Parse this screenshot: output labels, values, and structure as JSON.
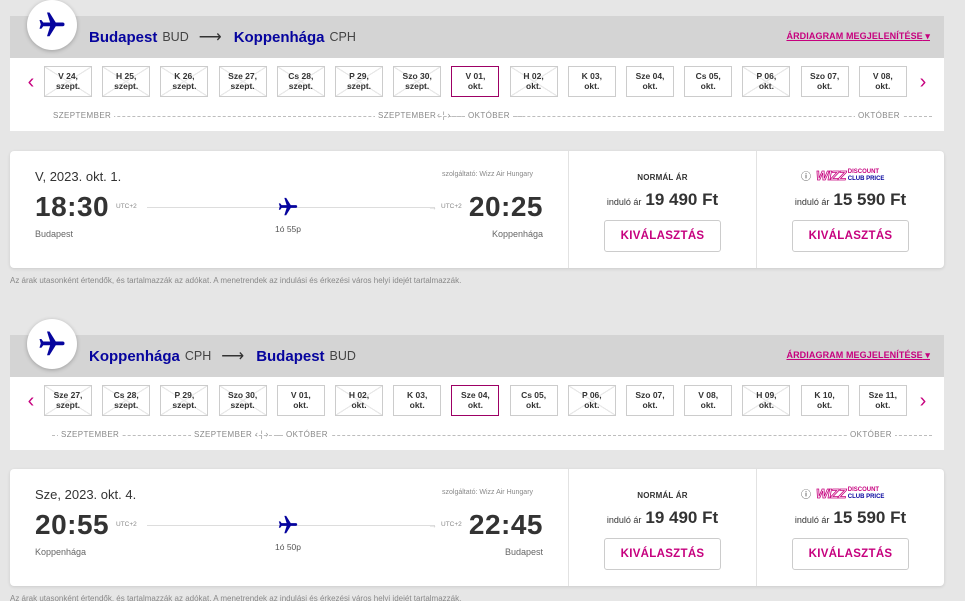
{
  "routes": [
    {
      "origin_city": "Budapest",
      "origin_code": "BUD",
      "dest_city": "Koppenhága",
      "dest_code": "CPH",
      "chart_link": "ÁRDIAGRAM MEGJELENÍTÉSE",
      "dates": [
        {
          "d1": "V 24,",
          "d2": "szept.",
          "available": false,
          "selected": false
        },
        {
          "d1": "H 25,",
          "d2": "szept.",
          "available": false,
          "selected": false
        },
        {
          "d1": "K 26,",
          "d2": "szept.",
          "available": false,
          "selected": false
        },
        {
          "d1": "Sze 27,",
          "d2": "szept.",
          "available": false,
          "selected": false
        },
        {
          "d1": "Cs 28,",
          "d2": "szept.",
          "available": false,
          "selected": false
        },
        {
          "d1": "P 29,",
          "d2": "szept.",
          "available": false,
          "selected": false
        },
        {
          "d1": "Szo 30,",
          "d2": "szept.",
          "available": false,
          "selected": false
        },
        {
          "d1": "V 01,",
          "d2": "okt.",
          "available": true,
          "selected": true
        },
        {
          "d1": "H 02,",
          "d2": "okt.",
          "available": false,
          "selected": false
        },
        {
          "d1": "K 03,",
          "d2": "okt.",
          "available": true,
          "selected": false
        },
        {
          "d1": "Sze 04,",
          "d2": "okt.",
          "available": true,
          "selected": false
        },
        {
          "d1": "Cs 05,",
          "d2": "okt.",
          "available": true,
          "selected": false
        },
        {
          "d1": "P 06,",
          "d2": "okt.",
          "available": false,
          "selected": false
        },
        {
          "d1": "Szo 07,",
          "d2": "okt.",
          "available": true,
          "selected": false
        },
        {
          "d1": "V 08,",
          "d2": "okt.",
          "available": true,
          "selected": false
        }
      ],
      "months": {
        "left": "SZEPTEMBER",
        "mid_left": "SZEPTEMBER",
        "mid_right": "OKTÓBER",
        "right": "OKTÓBER"
      }
    },
    {
      "origin_city": "Koppenhága",
      "origin_code": "CPH",
      "dest_city": "Budapest",
      "dest_code": "BUD",
      "chart_link": "ÁRDIAGRAM MEGJELENÍTÉSE",
      "dates": [
        {
          "d1": "Sze 27,",
          "d2": "szept.",
          "available": false,
          "selected": false
        },
        {
          "d1": "Cs 28,",
          "d2": "szept.",
          "available": false,
          "selected": false
        },
        {
          "d1": "P 29,",
          "d2": "szept.",
          "available": false,
          "selected": false
        },
        {
          "d1": "Szo 30,",
          "d2": "szept.",
          "available": false,
          "selected": false
        },
        {
          "d1": "V 01,",
          "d2": "okt.",
          "available": true,
          "selected": false
        },
        {
          "d1": "H 02,",
          "d2": "okt.",
          "available": false,
          "selected": false
        },
        {
          "d1": "K 03,",
          "d2": "okt.",
          "available": true,
          "selected": false
        },
        {
          "d1": "Sze 04,",
          "d2": "okt.",
          "available": true,
          "selected": true
        },
        {
          "d1": "Cs 05,",
          "d2": "okt.",
          "available": true,
          "selected": false
        },
        {
          "d1": "P 06,",
          "d2": "okt.",
          "available": false,
          "selected": false
        },
        {
          "d1": "Szo 07,",
          "d2": "okt.",
          "available": true,
          "selected": false
        },
        {
          "d1": "V 08,",
          "d2": "okt.",
          "available": true,
          "selected": false
        },
        {
          "d1": "H 09,",
          "d2": "okt.",
          "available": false,
          "selected": false
        },
        {
          "d1": "K 10,",
          "d2": "okt.",
          "available": true,
          "selected": false
        },
        {
          "d1": "Sze 11,",
          "d2": "okt.",
          "available": true,
          "selected": false
        }
      ],
      "months": {
        "left": "SZEPTEMBER",
        "mid_left": "SZEPTEMBER",
        "mid_right": "OKTÓBER",
        "right": "OKTÓBER"
      }
    }
  ],
  "flights": [
    {
      "date": "V, 2023. okt. 1.",
      "operator": "szolgáltató: Wizz Air Hungary",
      "dep_time": "18:30",
      "dep_tz": "UTC+2",
      "dep_city": "Budapest",
      "arr_time": "20:25",
      "arr_tz": "UTC+2",
      "arr_city": "Koppenhága",
      "duration": "1ó 55p",
      "normal_label": "NORMÁL ÁR",
      "from_label": "induló ár",
      "normal_price": "19 490 Ft",
      "club_brand": "WIZZ",
      "club_line1": "DISCOUNT",
      "club_line2": "CLUB PRICE",
      "club_price": "15 590 Ft",
      "select_label": "KIVÁLASZTÁS"
    },
    {
      "date": "Sze, 2023. okt. 4.",
      "operator": "szolgáltató: Wizz Air Hungary",
      "dep_time": "20:55",
      "dep_tz": "UTC+2",
      "dep_city": "Koppenhága",
      "arr_time": "22:45",
      "arr_tz": "UTC+2",
      "arr_city": "Budapest",
      "duration": "1ó 50p",
      "normal_label": "NORMÁL ÁR",
      "from_label": "induló ár",
      "normal_price": "19 490 Ft",
      "club_brand": "WIZZ",
      "club_line1": "DISCOUNT",
      "club_line2": "CLUB PRICE",
      "club_price": "15 590 Ft",
      "select_label": "KIVÁLASZTÁS"
    }
  ],
  "footnote": "Az árak utasonként értendők, és tartalmazzák az adókat. A menetrendek az indulási és érkezési város helyi idejét tartalmazzák.",
  "colors": {
    "brand_navy": "#06049e",
    "brand_magenta": "#c6007e",
    "selected_border": "#9d0065"
  },
  "icons": {
    "plane": "plane-icon",
    "arrow": "long-arrow-icon",
    "chevron_left": "chevron-left-icon",
    "chevron_right": "chevron-right-icon",
    "info": "info-icon"
  }
}
